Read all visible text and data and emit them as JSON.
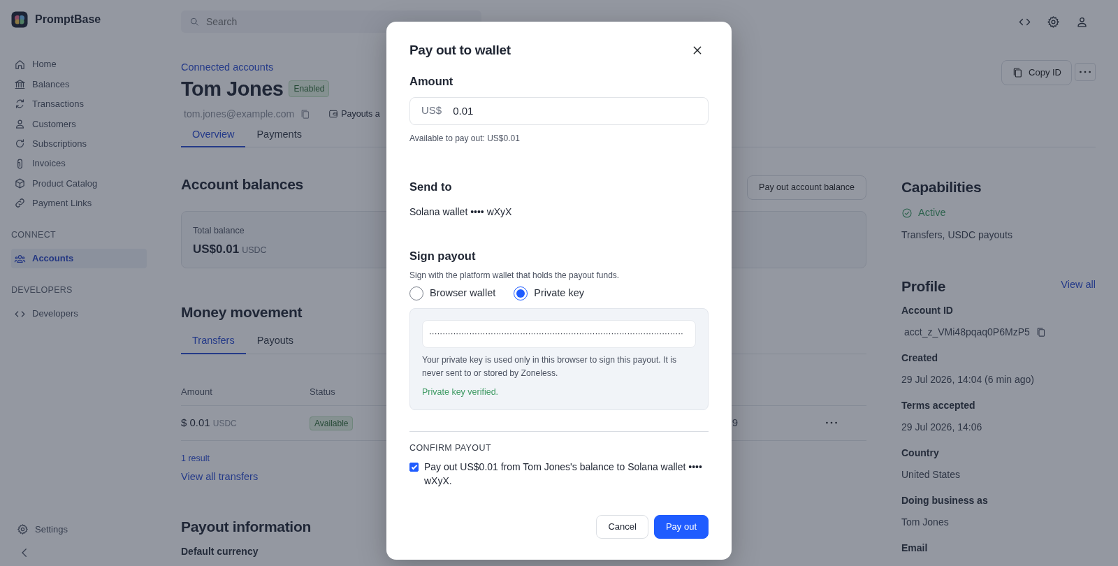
{
  "app": {
    "name": "PromptBase"
  },
  "sidebar": {
    "items": [
      {
        "label": "Home",
        "selected": false
      },
      {
        "label": "Balances",
        "selected": false
      },
      {
        "label": "Transactions",
        "selected": false
      },
      {
        "label": "Customers",
        "selected": false
      },
      {
        "label": "Subscriptions",
        "selected": false
      },
      {
        "label": "Invoices",
        "selected": false
      },
      {
        "label": "Product Catalog",
        "selected": false
      },
      {
        "label": "Payment Links",
        "selected": false
      }
    ],
    "sections": [
      {
        "title": "CONNECT",
        "items": [
          {
            "label": "Accounts",
            "selected": true
          }
        ]
      },
      {
        "title": "DEVELOPERS",
        "items": [
          {
            "label": "Developers",
            "selected": false
          }
        ]
      }
    ],
    "settings": "Settings"
  },
  "topbar": {
    "search": {
      "placeholder": "Search"
    }
  },
  "header": {
    "breadcrumb": "Connected accounts",
    "title": "Tom Jones",
    "status": "Enabled",
    "email": "tom.jones@example.com",
    "meta": "Payouts a",
    "copy_button": "Copy ID",
    "tabs": [
      {
        "label": "Overview",
        "selected": true
      },
      {
        "label": "Payments",
        "selected": false
      }
    ]
  },
  "balances": {
    "title": "Account balances",
    "action": "Pay out account balance",
    "card": {
      "label": "Total balance",
      "value": "US$0.01",
      "currency": "USDC"
    }
  },
  "money_movement": {
    "title": "Money movement",
    "tabs": [
      {
        "label": "Transfers",
        "selected": true
      },
      {
        "label": "Payouts",
        "selected": false
      }
    ],
    "table": {
      "columns": [
        "Amount",
        "Status"
      ],
      "rows": [
        {
          "amount": "$ 0.01",
          "currency": "USDC",
          "status": "Available",
          "column_3": "9"
        }
      ]
    },
    "count": "1 result",
    "link": "View all transfers"
  },
  "payout_information": {
    "title": "Payout information",
    "first_label": "Default currency"
  },
  "capabilities": {
    "title": "Capabilities",
    "status": "Active",
    "description": "Transfers, USDC payouts"
  },
  "profile": {
    "title": "Profile",
    "link": "View all",
    "fields": [
      {
        "label": "Account ID",
        "value": "acct_z_VMi48pqaq0P6MzP5",
        "copyable": true
      },
      {
        "label": "Created",
        "value": "29 Jul 2026, 14:04 (6 min ago)",
        "copyable": false
      },
      {
        "label": "Terms accepted",
        "value": "29 Jul 2026, 14:06",
        "copyable": false
      },
      {
        "label": "Country",
        "value": "United States",
        "copyable": false
      },
      {
        "label": "Doing business as",
        "value": "Tom Jones",
        "copyable": false
      },
      {
        "label": "Email"
      }
    ]
  },
  "modal": {
    "title": "Pay out to wallet",
    "amount": {
      "label": "Amount",
      "currency": "US$",
      "value": "0.01",
      "hint": "Available to pay out: US$0.01"
    },
    "send_to": {
      "label": "Send to",
      "value": "Solana wallet •••• wXyX"
    },
    "sign": {
      "label": "Sign payout",
      "description": "Sign with the platform wallet that holds the payout funds.",
      "options": [
        {
          "label": "Browser wallet",
          "selected": false
        },
        {
          "label": "Private key",
          "selected": true
        }
      ],
      "key_value": "·······························································································",
      "note": "Your private key is used only in this browser to sign this payout. It is never sent to or stored by Zoneless.",
      "verified": "Private key verified."
    },
    "confirm": {
      "heading": "CONFIRM PAYOUT",
      "checked": true,
      "label": "Pay out US$0.01 from Tom Jones's balance to Solana wallet •••• wXyX."
    },
    "buttons": [
      {
        "label": "Cancel",
        "kind": "secondary"
      },
      {
        "label": "Pay out",
        "kind": "primary"
      }
    ]
  }
}
